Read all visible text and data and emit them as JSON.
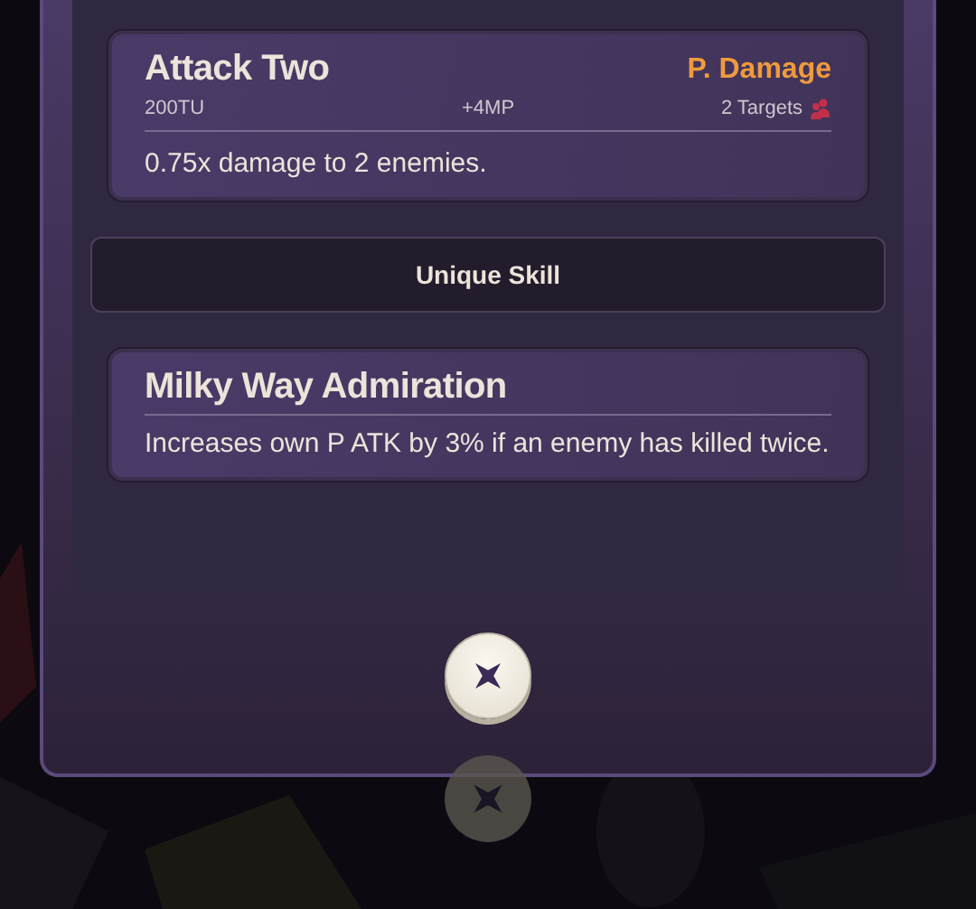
{
  "skills": [
    {
      "name": "Attack Two",
      "damage_type": "P. Damage",
      "cost": "200TU",
      "mp": "+4MP",
      "targets": "2 Targets",
      "description": "0.75x damage to 2 enemies."
    }
  ],
  "section_header": "Unique Skill",
  "unique_skills": [
    {
      "name": "Milky Way Admiration",
      "description": "Increases own P ATK by 3% if an enemy has killed twice."
    }
  ]
}
